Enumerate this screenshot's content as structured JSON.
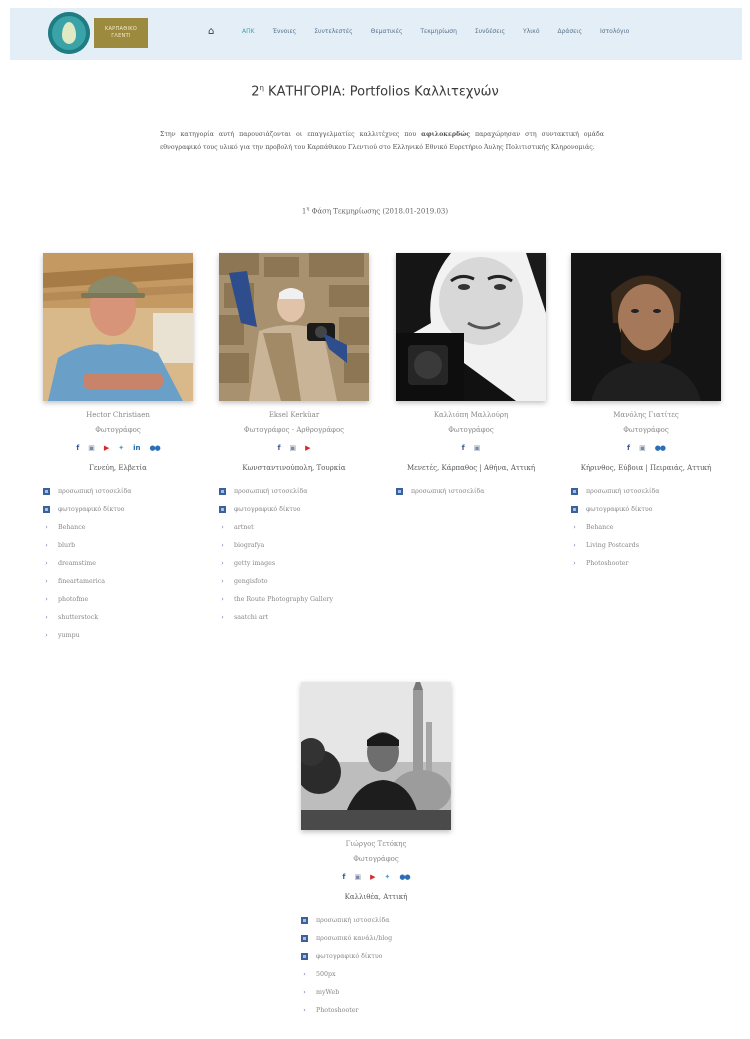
{
  "site": {
    "logo_line1": "ΚΑΡΠΑΘΙΚΟ",
    "logo_line2": "ΓΛΕΝΤΙ"
  },
  "nav": {
    "items": [
      "ΑΠΚ",
      "Έννοιες",
      "Συντελεστές",
      "Θεματικές",
      "Τεκμηρίωση",
      "Συνδέσεις",
      "Υλικό",
      "Δράσεις",
      "Ιστολόγιο"
    ]
  },
  "page": {
    "title_prefix": "2",
    "title_sup": "η",
    "title_rest": " ΚΑΤΗΓΟΡΙΑ: Portfolios Καλλιτεχνών",
    "intro_a": "Στην κατηγορία αυτή παρουσιάζονται οι επαγγελματίες καλλιτέχνες που ",
    "intro_bold": "αφιλοκερδώς",
    "intro_b": " παραχώρησαν στη συντακτική ομάδα εθνογραφικό τους υλικό για την προβολή του Καρπάθικου Γλεντιού στο Ελληνικό Εθνικό Ευρετήριο Άυλης Πολιτιστικής Κληρονομιάς.",
    "phase_prefix": "1",
    "phase_sup": "η",
    "phase_rest": " Φάση Τεκμηρίωσης (2018.01-2019.03)"
  },
  "artists": [
    {
      "name": "Hector Christiaen",
      "role": "Φωτογράφος",
      "location": "Γενεύη, Ελβετία",
      "links": [
        {
          "label": "προσωπική ιστοσελίδα",
          "type": "square"
        },
        {
          "label": "φωτογραφικό δίκτυο",
          "type": "square"
        },
        {
          "label": "Behance",
          "type": "chevron"
        },
        {
          "label": "blurb",
          "type": "chevron"
        },
        {
          "label": "dreamstime",
          "type": "chevron"
        },
        {
          "label": "fineartamerica",
          "type": "chevron"
        },
        {
          "label": "photofme",
          "type": "chevron"
        },
        {
          "label": "shutterstock",
          "type": "chevron"
        },
        {
          "label": "yumpu",
          "type": "chevron"
        }
      ]
    },
    {
      "name": "Eksel Kerküar",
      "role": "Φωτογράφος - Αρθρογράφος",
      "location": "Κωνσταντινούπολη, Τουρκία",
      "links": [
        {
          "label": "προσωπική ιστοσελίδα",
          "type": "square"
        },
        {
          "label": "φωτογραφικό δίκτυο",
          "type": "square"
        },
        {
          "label": "artnet",
          "type": "chevron"
        },
        {
          "label": "biografya",
          "type": "chevron"
        },
        {
          "label": "getty images",
          "type": "chevron"
        },
        {
          "label": "gengisfoto",
          "type": "chevron"
        },
        {
          "label": "the Route Photography Gallery",
          "type": "chevron"
        },
        {
          "label": "saatchi art",
          "type": "chevron"
        }
      ]
    },
    {
      "name": "Καλλιόπη Μαλλούρη",
      "role": "Φωτογράφος",
      "location": "Μενετές, Κάρπαθος | Αθήνα, Αττική",
      "links": [
        {
          "label": "προσωπική ιστοσελίδα",
          "type": "square"
        }
      ]
    },
    {
      "name": "Μανόλης Γιατίτες",
      "role": "Φωτογράφος",
      "location": "Κήρινθος, Εύβοια | Πειραιάς, Αττική",
      "links": [
        {
          "label": "προσωπική ιστοσελίδα",
          "type": "square"
        },
        {
          "label": "φωτογραφικό δίκτυο",
          "type": "square"
        },
        {
          "label": "Behance",
          "type": "chevron"
        },
        {
          "label": "Living Postcards",
          "type": "chevron"
        },
        {
          "label": "Photoshooter",
          "type": "chevron"
        }
      ]
    },
    {
      "name": "Γιώργος Τετόκης",
      "role": "Φωτογράφος",
      "location": "Καλλιθέα, Αττική",
      "links": [
        {
          "label": "προσωπική ιστοσελίδα",
          "type": "square"
        },
        {
          "label": "προσωπικό κανάλι/blog",
          "type": "square"
        },
        {
          "label": "φωτογραφικό δίκτυο",
          "type": "square"
        },
        {
          "label": "500px",
          "type": "chevron"
        },
        {
          "label": "myWeb",
          "type": "chevron"
        },
        {
          "label": "Photoshooter",
          "type": "chevron"
        }
      ]
    }
  ],
  "colors": {
    "topbar": "#e4eef7",
    "accent": "#3ea3a8",
    "link_bullet": "#3d5f9c"
  }
}
